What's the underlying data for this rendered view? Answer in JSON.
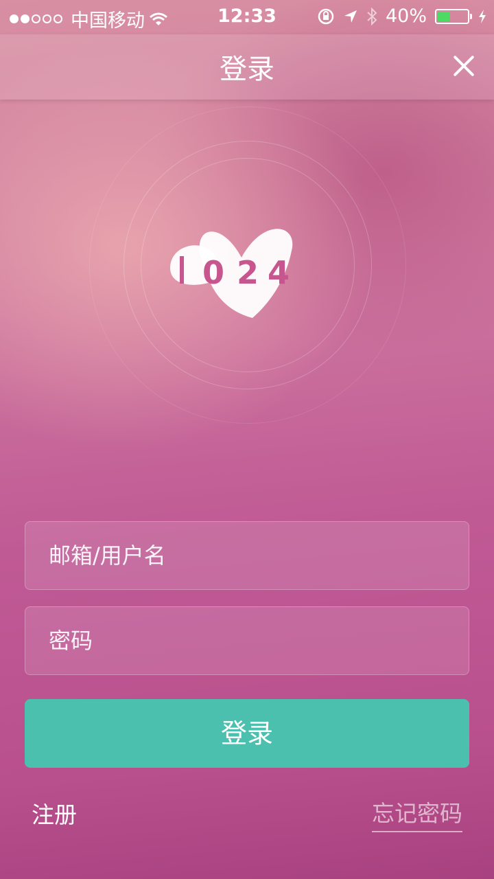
{
  "status_bar": {
    "carrier": "中国移动",
    "time": "12:33",
    "battery_percent": "40%",
    "battery_level": 0.4,
    "battery_color": "#4cd964",
    "icons": [
      "signal-dots-icon",
      "wifi-icon",
      "rotation-lock-icon",
      "location-icon",
      "bluetooth-icon",
      "battery-icon",
      "charging-icon"
    ]
  },
  "nav": {
    "title": "登录",
    "close_icon": "close-icon"
  },
  "logo": {
    "text": "1024"
  },
  "form": {
    "username_placeholder": "邮箱/用户名",
    "password_placeholder": "密码",
    "login_label": "登录",
    "register_label": "注册",
    "forgot_label": "忘记密码"
  },
  "colors": {
    "accent": "#4bc0ae",
    "background": "#c05a95"
  }
}
